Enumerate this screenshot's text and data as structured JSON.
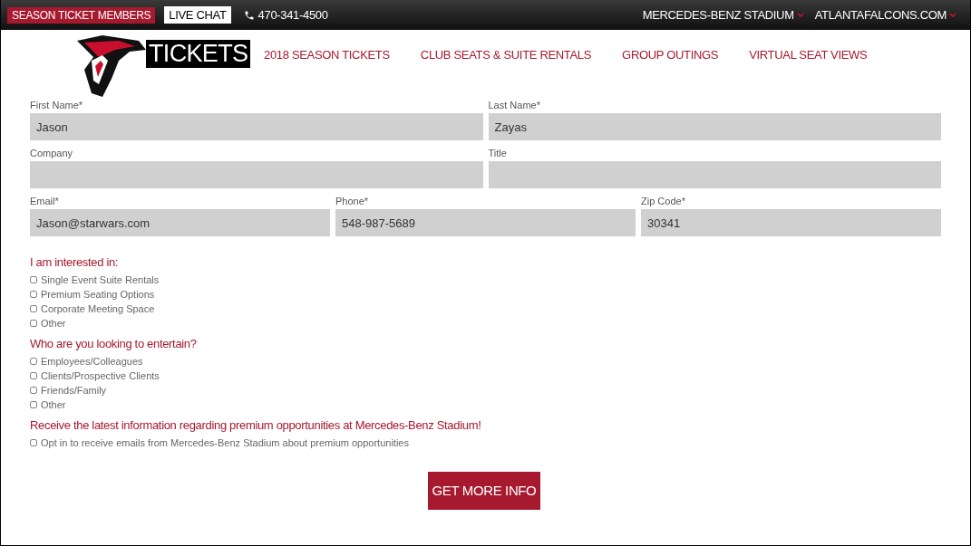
{
  "top_bar": {
    "members_badge": "SEASON TICKET MEMBERS",
    "live_chat": "LIVE CHAT",
    "phone": "470-341-4500",
    "links": [
      {
        "label": "MERCEDES-BENZ STADIUM"
      },
      {
        "label": "ATLANTAFALCONS.COM"
      }
    ]
  },
  "header": {
    "logo_text": "TICKETS",
    "nav": [
      "2018 SEASON TICKETS",
      "CLUB SEATS & SUITE RENTALS",
      "GROUP OUTINGS",
      "VIRTUAL SEAT VIEWS"
    ]
  },
  "form": {
    "rows": [
      [
        {
          "label": "First Name*",
          "value": "Jason"
        },
        {
          "label": "Last Name*",
          "value": "Zayas"
        }
      ],
      [
        {
          "label": "Company"
        },
        {
          "label": "Title"
        }
      ],
      [
        {
          "label": "Email*",
          "value": "Jason@starwars.com"
        },
        {
          "label": "Phone*",
          "value": "548-987-5689"
        },
        {
          "label": "Zip Code*",
          "value": "30341"
        }
      ]
    ],
    "groups": [
      {
        "heading": "I am interested in:",
        "options": [
          {
            "label": "Single Event Suite Rentals",
            "checked": false
          },
          {
            "label": "Premium Seating Options",
            "checked": false
          },
          {
            "label": "Corporate Meeting Space",
            "checked": false
          },
          {
            "label": "Other",
            "checked": false
          }
        ]
      },
      {
        "heading": "Who are you looking to entertain?",
        "options": [
          {
            "label": "Employees/Colleagues",
            "checked": false
          },
          {
            "label": "Clients/Prospective Clients",
            "checked": false
          },
          {
            "label": "Friends/Family",
            "checked": false
          },
          {
            "label": "Other",
            "checked": false
          }
        ]
      },
      {
        "heading": "Receive the latest information regarding premium opportunities at Mercedes-Benz Stadium!",
        "options": [
          {
            "label": "Opt in to receive emails from Mercedes-Benz Stadium about premium opportunities",
            "checked": false
          }
        ]
      }
    ],
    "submit": "GET MORE INFO"
  }
}
